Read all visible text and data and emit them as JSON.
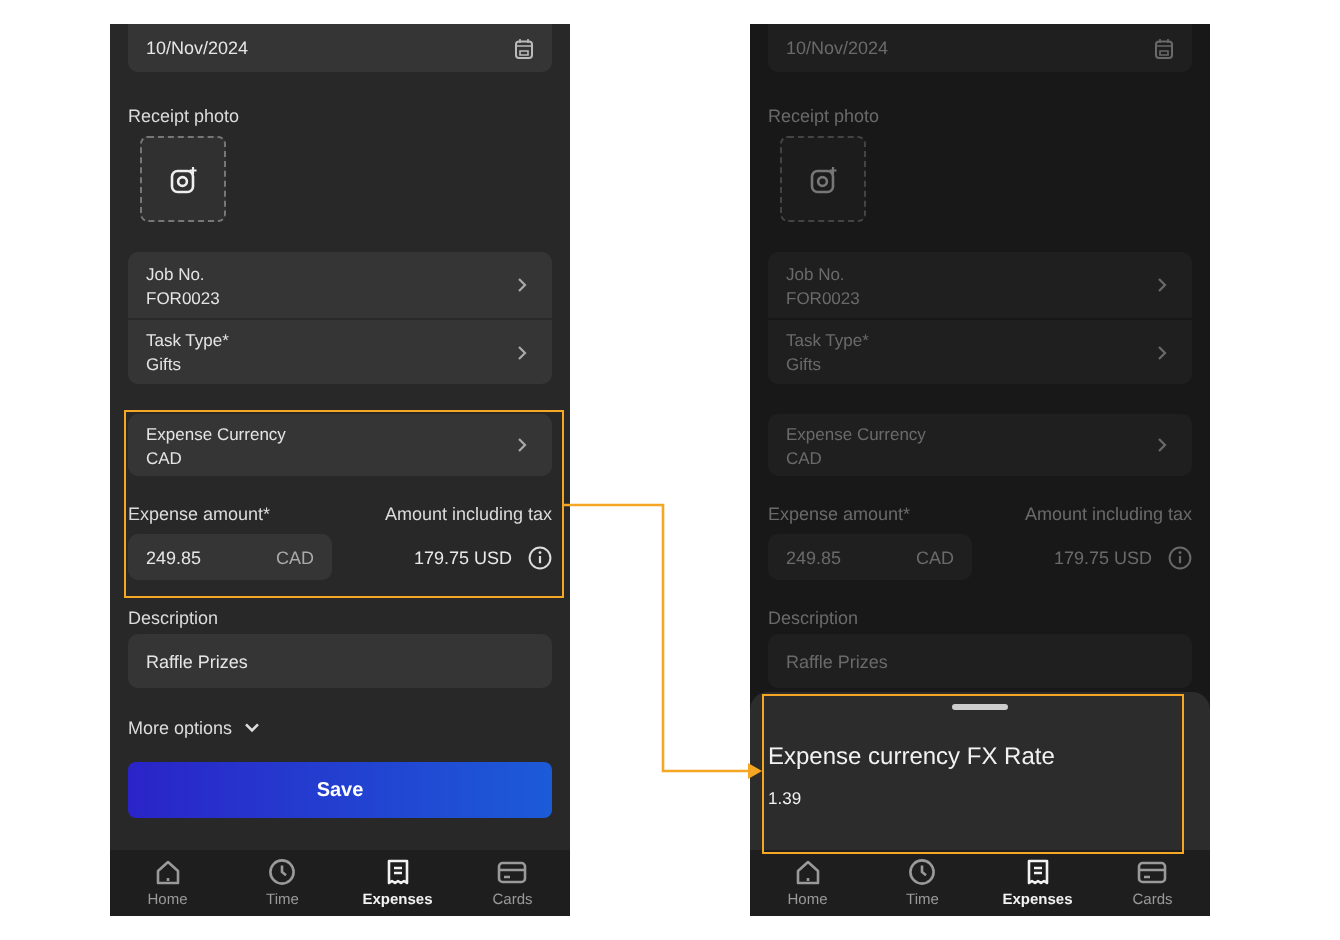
{
  "screens": [
    {
      "dimmed": false,
      "date": "10/Nov/2024",
      "receipt_label": "Receipt photo",
      "fields": [
        {
          "label": "Job No.",
          "value": "FOR0023"
        },
        {
          "label": "Task Type*",
          "value": "Gifts"
        }
      ],
      "currency": {
        "label": "Expense Currency",
        "value": "CAD"
      },
      "amount": {
        "label": "Expense amount*",
        "value": "249.85",
        "unit": "CAD"
      },
      "tax": {
        "label": "Amount including tax",
        "value": "179.75 USD"
      },
      "description": {
        "label": "Description",
        "value": "Raffle Prizes"
      },
      "more_options": "More options",
      "save": "Save",
      "nav": [
        {
          "label": "Home",
          "selected": false
        },
        {
          "label": "Time",
          "selected": false
        },
        {
          "label": "Expenses",
          "selected": true
        },
        {
          "label": "Cards",
          "selected": false
        }
      ]
    },
    {
      "dimmed": true,
      "date": "10/Nov/2024",
      "receipt_label": "Receipt photo",
      "fields": [
        {
          "label": "Job No.",
          "value": "FOR0023"
        },
        {
          "label": "Task Type*",
          "value": "Gifts"
        }
      ],
      "currency": {
        "label": "Expense Currency",
        "value": "CAD"
      },
      "amount": {
        "label": "Expense amount*",
        "value": "249.85",
        "unit": "CAD"
      },
      "tax": {
        "label": "Amount including tax",
        "value": "179.75 USD"
      },
      "description": {
        "label": "Description",
        "value": "Raffle Prizes"
      },
      "sheet": {
        "title": "Expense currency FX Rate",
        "value": "1.39"
      },
      "nav": [
        {
          "label": "Home",
          "selected": false
        },
        {
          "label": "Time",
          "selected": false
        },
        {
          "label": "Expenses",
          "selected": true
        },
        {
          "label": "Cards",
          "selected": false
        }
      ]
    }
  ]
}
